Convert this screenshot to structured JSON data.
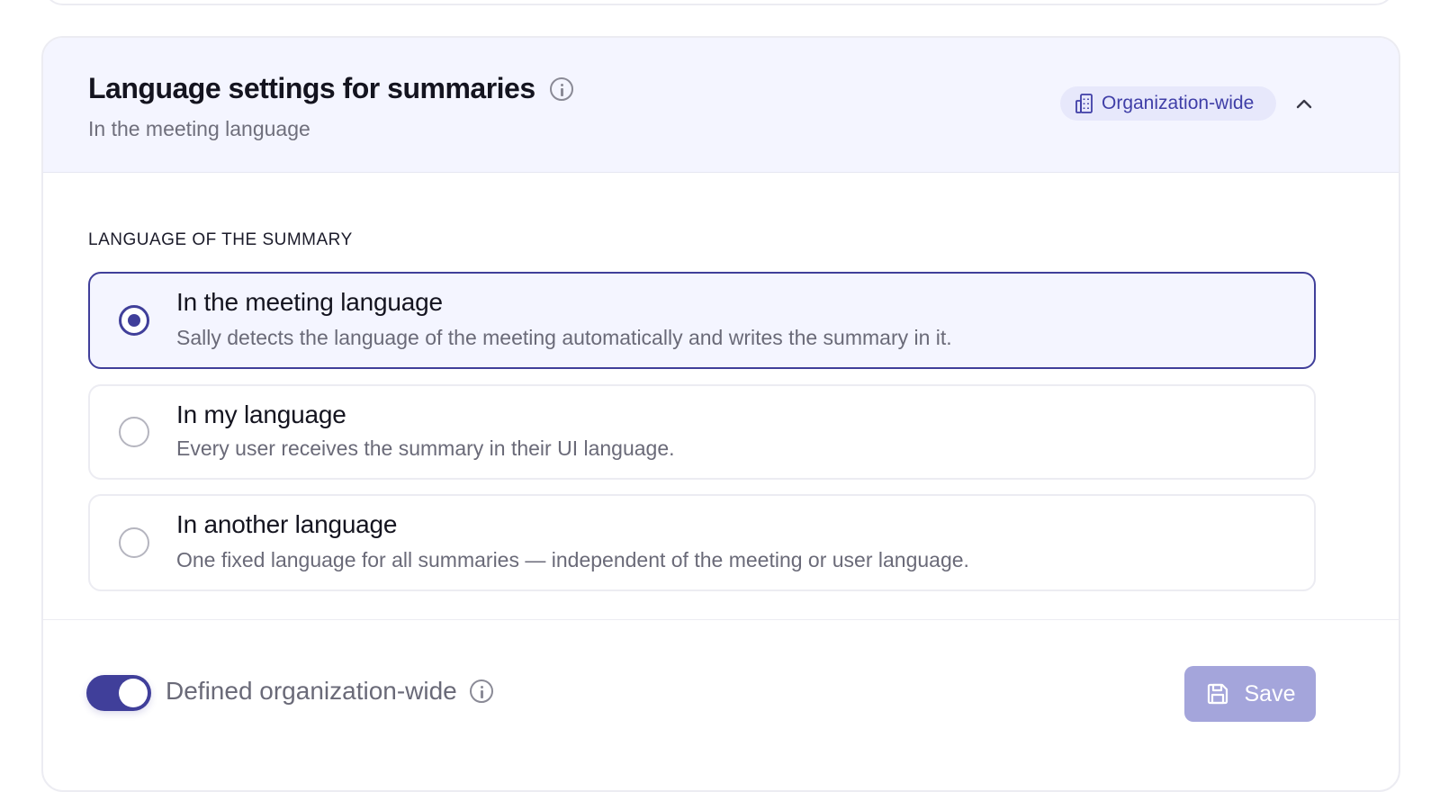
{
  "header": {
    "title": "Language settings for summaries",
    "subtitle": "In the meeting language",
    "scope_badge": "Organization-wide"
  },
  "section": {
    "label": "LANGUAGE OF THE SUMMARY"
  },
  "options": [
    {
      "title": "In the meeting language",
      "description": "Sally detects the language of the meeting automatically and writes the summary in it.",
      "selected": true
    },
    {
      "title": "In my language",
      "description": "Every user receives the summary in their UI language.",
      "selected": false
    },
    {
      "title": "In another language",
      "description": "One fixed language for all summaries — independent of the meeting or user language.",
      "selected": false
    }
  ],
  "footer": {
    "toggle_label": "Defined organization-wide",
    "toggle_on": true,
    "save_label": "Save"
  },
  "colors": {
    "accent": "#403f9a",
    "header_bg": "#f4f5ff",
    "badge_bg": "#e7e8fb",
    "save_disabled_bg": "#a4a5db"
  },
  "icons": [
    "info-icon",
    "building-icon",
    "chevron-up-icon",
    "save-icon"
  ]
}
